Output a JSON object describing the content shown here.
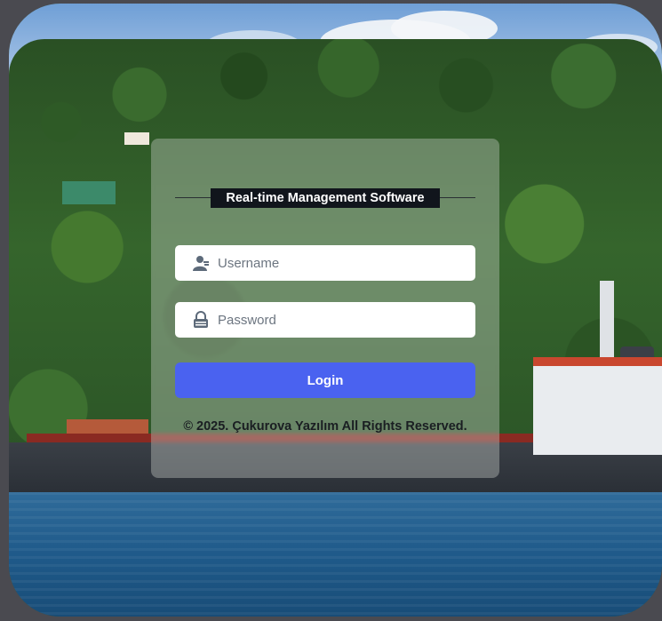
{
  "login": {
    "title": "Real-time Management Software",
    "username_placeholder": "Username",
    "password_placeholder": "Password",
    "login_label": "Login",
    "footer": "© 2025. Çukurova Yazılım All Rights Reserved."
  },
  "icons": {
    "username": "user-icon",
    "password": "lock-icon"
  },
  "colors": {
    "login_button": "#4a62f0",
    "title_background": "#11151c",
    "page_background": "#4a4a50"
  }
}
